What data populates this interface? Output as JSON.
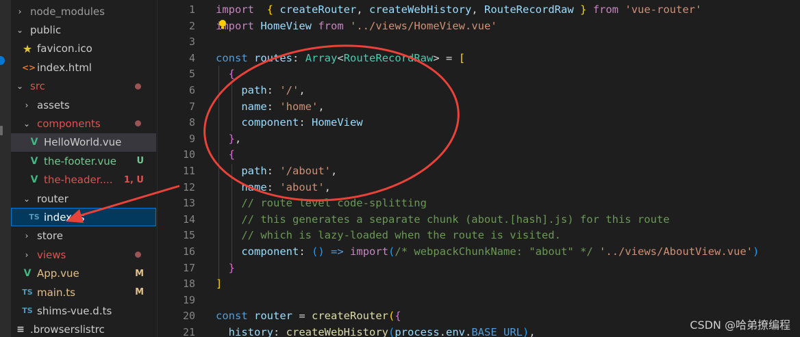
{
  "colors": {
    "annotation_red": "#e8433a",
    "selection_blue": "#04395e",
    "accent": "#0078d4"
  },
  "explorer": {
    "items": [
      {
        "label": "node_modules",
        "kind": "folder-closed",
        "depth": 1,
        "color": "dim"
      },
      {
        "label": "public",
        "kind": "folder-open",
        "depth": 1
      },
      {
        "label": "favicon.ico",
        "kind": "file",
        "icon": "star-icon",
        "depth": 2
      },
      {
        "label": "index.html",
        "kind": "file",
        "icon": "html-icon",
        "depth": 2
      },
      {
        "label": "src",
        "kind": "folder-open",
        "depth": 1,
        "color": "red",
        "dot": true
      },
      {
        "label": "assets",
        "kind": "folder-closed",
        "depth": 2
      },
      {
        "label": "components",
        "kind": "folder-open",
        "depth": 2,
        "color": "red",
        "dot": true
      },
      {
        "label": "HelloWorld.vue",
        "kind": "file",
        "icon": "vue-icon",
        "depth": 3,
        "hover": true
      },
      {
        "label": "the-footer.vue",
        "kind": "file",
        "icon": "vue-icon",
        "depth": 3,
        "color": "green",
        "status": "U"
      },
      {
        "label": "the-header....",
        "kind": "file",
        "icon": "vue-icon",
        "depth": 3,
        "color": "red",
        "status": "1, U"
      },
      {
        "label": "router",
        "kind": "folder-open",
        "depth": 2
      },
      {
        "label": "index.ts",
        "kind": "file",
        "icon": "ts-icon",
        "depth": 3,
        "selected": true
      },
      {
        "label": "store",
        "kind": "folder-closed",
        "depth": 2
      },
      {
        "label": "views",
        "kind": "folder-closed",
        "depth": 2,
        "color": "red",
        "dot": true
      },
      {
        "label": "App.vue",
        "kind": "file",
        "icon": "vue-icon",
        "depth": 2,
        "color": "yellow",
        "status": "M"
      },
      {
        "label": "main.ts",
        "kind": "file",
        "icon": "ts-icon",
        "depth": 2,
        "color": "yellow",
        "status": "M"
      },
      {
        "label": "shims-vue.d.ts",
        "kind": "file",
        "icon": "ts-icon",
        "depth": 2
      },
      {
        "label": ".browserslistrc",
        "kind": "file",
        "icon": "lines-icon",
        "depth": 1
      }
    ]
  },
  "editor": {
    "line_numbers": [
      "1",
      "2",
      "3",
      "4",
      "5",
      "6",
      "7",
      "8",
      "9",
      "10",
      "11",
      "12",
      "13",
      "14",
      "15",
      "16",
      "17",
      "18",
      "19",
      "20",
      "21"
    ],
    "lines": [
      [
        [
          "kw2",
          "import"
        ],
        [
          "",
          "  "
        ],
        [
          "br1",
          "{"
        ],
        [
          "",
          " "
        ],
        [
          "id",
          "createRouter"
        ],
        [
          "",
          ", "
        ],
        [
          "id",
          "createWebHistory"
        ],
        [
          "",
          ", "
        ],
        [
          "id",
          "RouteRecordRaw"
        ],
        [
          "",
          " "
        ],
        [
          "br1",
          "}"
        ],
        [
          "",
          " "
        ],
        [
          "kw2",
          "from"
        ],
        [
          "",
          " "
        ],
        [
          "str",
          "'vue-router'"
        ]
      ],
      [
        [
          "kw2",
          "import"
        ],
        [
          "",
          " "
        ],
        [
          "id",
          "HomeView"
        ],
        [
          "",
          " "
        ],
        [
          "kw2",
          "from"
        ],
        [
          "",
          " "
        ],
        [
          "str",
          "'../views/HomeView.vue'"
        ]
      ],
      [],
      [
        [
          "kw",
          "const"
        ],
        [
          "",
          " "
        ],
        [
          "id",
          "routes"
        ],
        [
          "",
          ": "
        ],
        [
          "ty",
          "Array"
        ],
        [
          "",
          "<"
        ],
        [
          "ty",
          "RouteRecordRaw"
        ],
        [
          "",
          "> = "
        ],
        [
          "br1",
          "["
        ]
      ],
      [
        [
          "",
          "  "
        ],
        [
          "br2",
          "{"
        ]
      ],
      [
        [
          "",
          "    "
        ],
        [
          "id",
          "path"
        ],
        [
          "",
          ": "
        ],
        [
          "str",
          "'/'"
        ],
        [
          "",
          ","
        ]
      ],
      [
        [
          "",
          "    "
        ],
        [
          "id",
          "name"
        ],
        [
          "",
          ": "
        ],
        [
          "str",
          "'home'"
        ],
        [
          "",
          ","
        ]
      ],
      [
        [
          "",
          "    "
        ],
        [
          "id",
          "component"
        ],
        [
          "",
          ": "
        ],
        [
          "id",
          "HomeView"
        ]
      ],
      [
        [
          "",
          "  "
        ],
        [
          "br2",
          "}"
        ],
        [
          "",
          ","
        ]
      ],
      [
        [
          "",
          "  "
        ],
        [
          "br2",
          "{"
        ]
      ],
      [
        [
          "",
          "    "
        ],
        [
          "id",
          "path"
        ],
        [
          "",
          ": "
        ],
        [
          "str",
          "'/about'"
        ],
        [
          "",
          ","
        ]
      ],
      [
        [
          "",
          "    "
        ],
        [
          "id",
          "name"
        ],
        [
          "",
          ": "
        ],
        [
          "str",
          "'about'"
        ],
        [
          "",
          ","
        ]
      ],
      [
        [
          "",
          "    "
        ],
        [
          "cm",
          "// route level code-splitting"
        ]
      ],
      [
        [
          "",
          "    "
        ],
        [
          "cm",
          "// this generates a separate chunk (about.[hash].js) for this route"
        ]
      ],
      [
        [
          "",
          "    "
        ],
        [
          "cm",
          "// which is lazy-loaded when the route is visited."
        ]
      ],
      [
        [
          "",
          "    "
        ],
        [
          "id",
          "component"
        ],
        [
          "",
          ": "
        ],
        [
          "br3",
          "()"
        ],
        [
          "",
          " "
        ],
        [
          "kw",
          "=>"
        ],
        [
          "",
          " "
        ],
        [
          "kw2",
          "import"
        ],
        [
          "br3",
          "("
        ],
        [
          "cm",
          "/* webpackChunkName: \"about\" */"
        ],
        [
          "",
          " "
        ],
        [
          "str",
          "'../views/AboutView.vue'"
        ],
        [
          "br3",
          ")"
        ]
      ],
      [
        [
          "",
          "  "
        ],
        [
          "br2",
          "}"
        ]
      ],
      [
        [
          "br1",
          "]"
        ]
      ],
      [],
      [
        [
          "kw",
          "const"
        ],
        [
          "",
          " "
        ],
        [
          "id",
          "router"
        ],
        [
          "",
          " = "
        ],
        [
          "fn",
          "createRouter"
        ],
        [
          "br1",
          "("
        ],
        [
          "br2",
          "{"
        ]
      ],
      [
        [
          "",
          "  "
        ],
        [
          "id",
          "history"
        ],
        [
          "",
          ": "
        ],
        [
          "fn",
          "createWebHistory"
        ],
        [
          "br3",
          "("
        ],
        [
          "id",
          "process"
        ],
        [
          "",
          "."
        ],
        [
          "id",
          "env"
        ],
        [
          "",
          "."
        ],
        [
          "kw",
          "BASE_URL"
        ],
        [
          "br3",
          ")"
        ],
        [
          "",
          ","
        ]
      ]
    ]
  },
  "watermark": "CSDN @哈弟撩编程"
}
